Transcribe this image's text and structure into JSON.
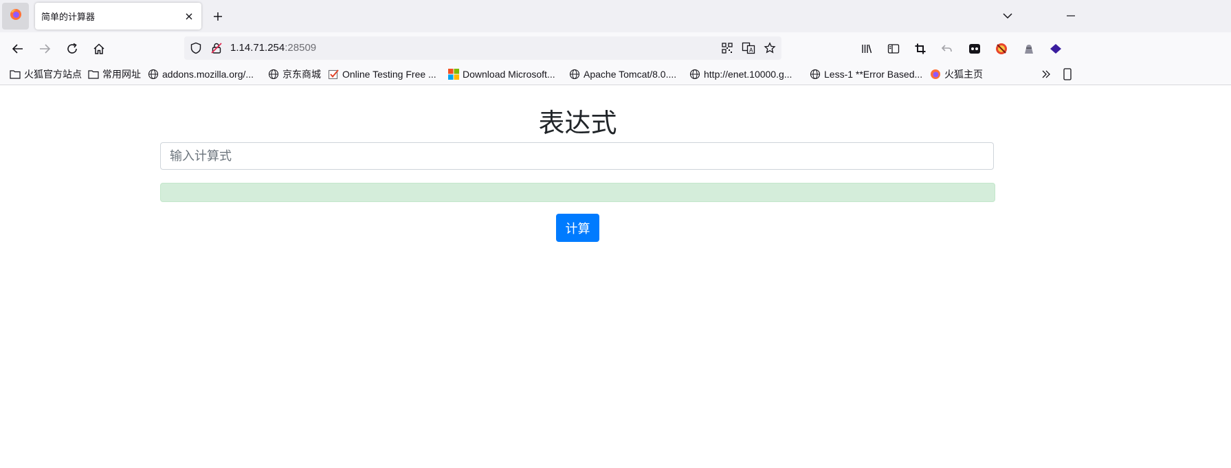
{
  "tab": {
    "title": "简单的计算器"
  },
  "address": {
    "host": "1.14.71.254",
    "port": ":28509"
  },
  "bookmarks": [
    {
      "label": "火狐官方站点",
      "icon": "folder-icon"
    },
    {
      "label": "常用网址",
      "icon": "folder-icon"
    },
    {
      "label": "addons.mozilla.org/...",
      "icon": "globe-icon"
    },
    {
      "label": "京东商城",
      "icon": "globe-icon"
    },
    {
      "label": "Online Testing Free ...",
      "icon": "checkbox-icon"
    },
    {
      "label": "Download Microsoft...",
      "icon": "microsoft-icon"
    },
    {
      "label": "Apache Tomcat/8.0....",
      "icon": "globe-icon"
    },
    {
      "label": "http://enet.10000.g...",
      "icon": "globe-icon"
    },
    {
      "label": "Less-1 **Error Based...",
      "icon": "globe-icon"
    },
    {
      "label": "火狐主页",
      "icon": "firefox-icon"
    }
  ],
  "page": {
    "heading": "表达式",
    "input_placeholder": "输入计算式",
    "input_value": "",
    "button_label": "计算"
  },
  "colors": {
    "primary": "#007bff",
    "result_bg": "#d4edda",
    "result_border": "#c3e6cb"
  }
}
